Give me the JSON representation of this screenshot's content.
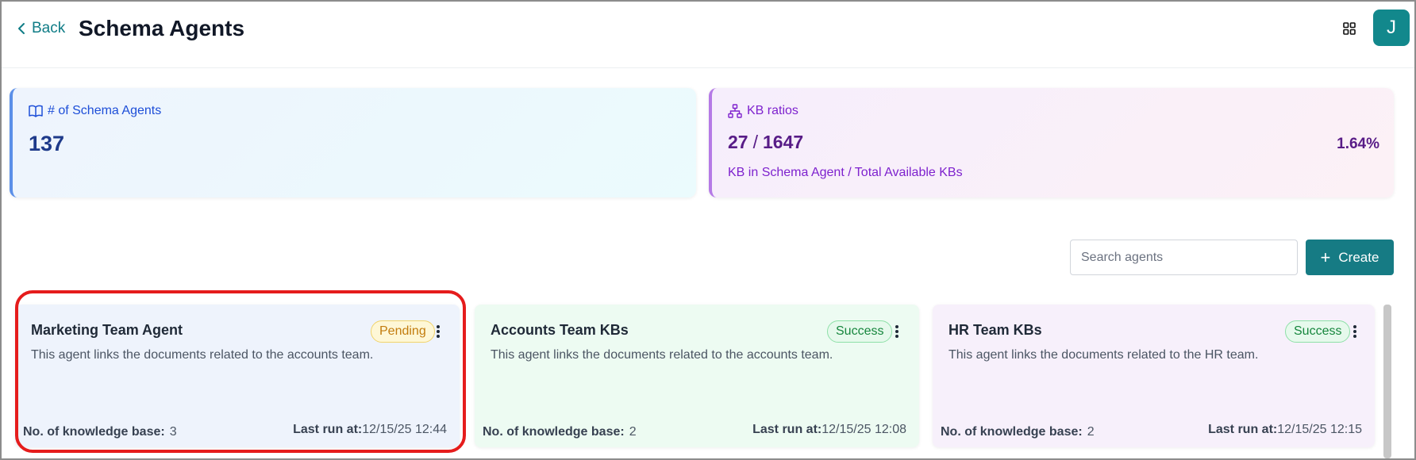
{
  "header": {
    "back_label": "Back",
    "title": "Schema Agents",
    "avatar_initial": "J"
  },
  "stats": {
    "agents_label": "# of Schema Agents",
    "agents_value": "137",
    "kb_label": "KB ratios",
    "kb_numerator": "27",
    "kb_separator": "/",
    "kb_denominator": "1647",
    "kb_percent": "1.64%",
    "kb_caption": "KB in Schema Agent / Total Available KBs"
  },
  "toolbar": {
    "search_placeholder": "Search agents",
    "create_label": "Create"
  },
  "agents": [
    {
      "title": "Marketing Team Agent",
      "status": "Pending",
      "description": "This agent links the documents related to the accounts team.",
      "kb_label": "No. of knowledge base:",
      "kb_count": "3",
      "last_run_label": "Last run at:",
      "last_run": "12/15/25 12:44"
    },
    {
      "title": "Accounts Team KBs",
      "status": "Success",
      "description": "This agent links the documents related to the accounts team.",
      "kb_label": "No. of knowledge base:",
      "kb_count": "2",
      "last_run_label": "Last run at:",
      "last_run": "12/15/25 12:08"
    },
    {
      "title": "HR Team KBs",
      "status": "Success",
      "description": "This agent links the documents related to the HR team.",
      "kb_label": "No. of knowledge base:",
      "kb_count": "2",
      "last_run_label": "Last run at:",
      "last_run": "12/15/25 12:15"
    }
  ],
  "colors": {
    "accent": "#167b84",
    "highlight": "#e51c1c",
    "pending": "#c27c0e",
    "success": "#16863d"
  },
  "icons": [
    "chevron-left-icon",
    "grid-icon",
    "book-icon",
    "hierarchy-icon",
    "plus-icon",
    "kebab-icon"
  ]
}
